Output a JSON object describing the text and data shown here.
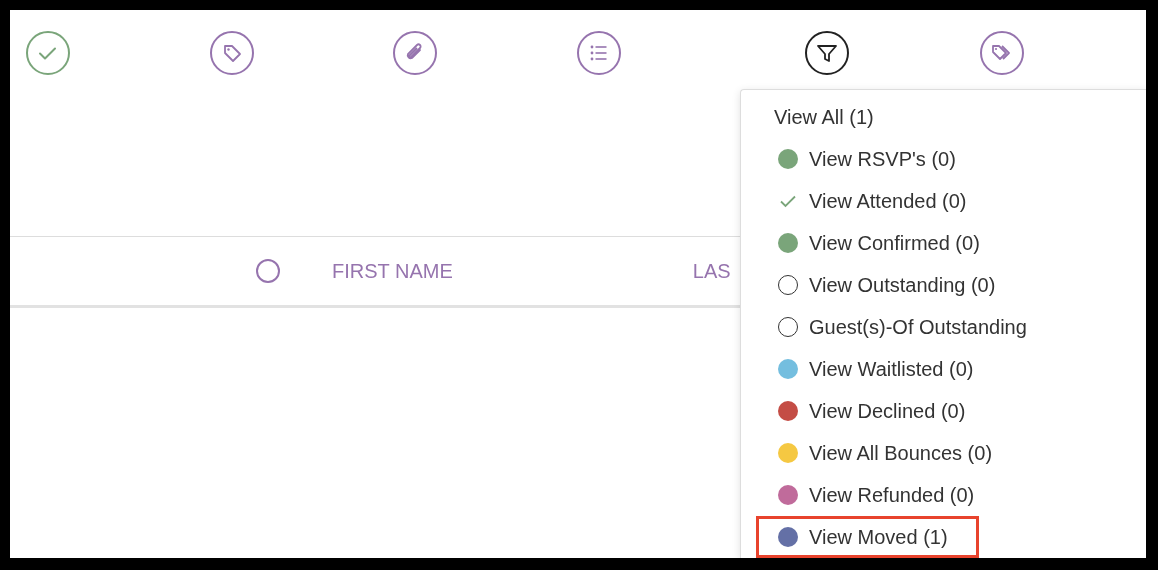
{
  "toolbar": [
    {
      "kind": "check",
      "active": false
    },
    {
      "kind": "tag",
      "active": false
    },
    {
      "kind": "paperclip",
      "active": false
    },
    {
      "kind": "list",
      "active": false
    },
    {
      "kind": "filter",
      "active": true
    },
    {
      "kind": "tags",
      "active": false
    }
  ],
  "table": {
    "columns": [
      {
        "kind": "select",
        "checked": false
      },
      {
        "kind": "text",
        "label": "FIRST NAME"
      },
      {
        "kind": "text",
        "label": "LAS"
      }
    ]
  },
  "filter_menu": {
    "items": [
      {
        "kind": "plain",
        "label": "View All (1)",
        "highlighted": false
      },
      {
        "kind": "dot",
        "label": "View RSVP's (0)",
        "color": "#7aa57a",
        "highlighted": false
      },
      {
        "kind": "check",
        "label": "View Attended (0)",
        "highlighted": false
      },
      {
        "kind": "dot",
        "label": "View Confirmed (0)",
        "color": "#7aa57a",
        "highlighted": false
      },
      {
        "kind": "ring",
        "label": "View Outstanding (0)",
        "highlighted": false
      },
      {
        "kind": "ring",
        "label": "Guest(s)-Of Outstanding",
        "highlighted": false
      },
      {
        "kind": "dot",
        "label": "View Waitlisted (0)",
        "color": "#74bedf",
        "highlighted": false
      },
      {
        "kind": "dot",
        "label": "View Declined (0)",
        "color": "#c44d45",
        "highlighted": false
      },
      {
        "kind": "dot",
        "label": "View All Bounces (0)",
        "color": "#f5c842",
        "highlighted": false
      },
      {
        "kind": "dot",
        "label": "View Refunded (0)",
        "color": "#c06b9b",
        "highlighted": false
      },
      {
        "kind": "dot",
        "label": "View Moved (1)",
        "color": "#6470a6",
        "highlighted": true
      }
    ]
  }
}
